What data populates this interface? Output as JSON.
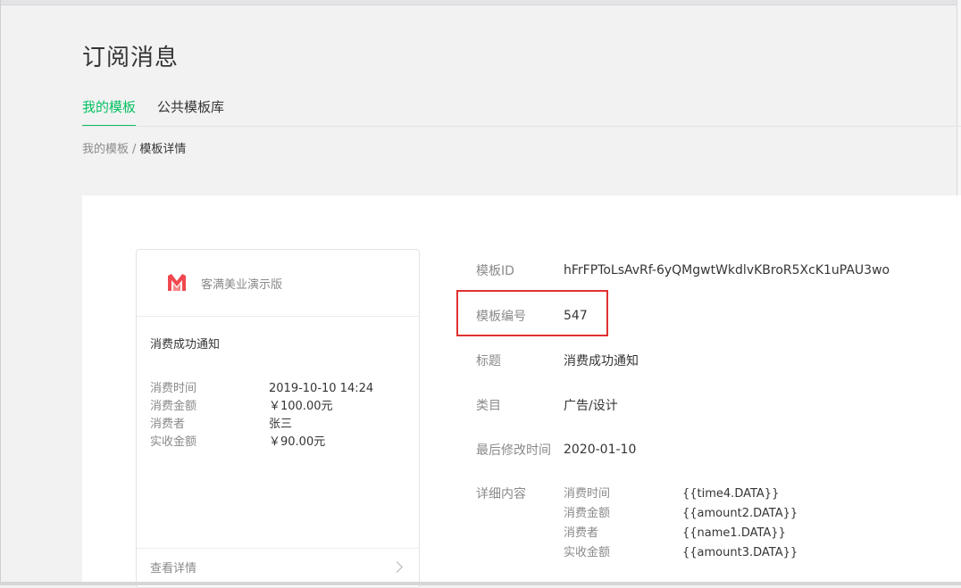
{
  "page": {
    "title": "订阅消息"
  },
  "tabs": [
    {
      "label": "我的模板",
      "active": true
    },
    {
      "label": "公共模板库",
      "active": false
    }
  ],
  "breadcrumb": {
    "parent": "我的模板",
    "separator": "/",
    "current": "模板详情"
  },
  "preview": {
    "app_name": "客满美业演示版",
    "message_title": "消费成功通知",
    "fields": [
      {
        "key": "消费时间",
        "value": "2019-10-10 14:24"
      },
      {
        "key": "消费金额",
        "value": "￥100.00元"
      },
      {
        "key": "消费者",
        "value": "张三"
      },
      {
        "key": "实收金额",
        "value": "￥90.00元"
      }
    ],
    "footer_label": "查看详情"
  },
  "info": {
    "template_id": {
      "label": "模板ID",
      "value": "hFrFPToLsAvRf-6yQMgwtWkdlvKBroR5XcK1uPAU3wo"
    },
    "template_number": {
      "label": "模板编号",
      "value": "547"
    },
    "title": {
      "label": "标题",
      "value": "消费成功通知"
    },
    "category": {
      "label": "类目",
      "value": "广告/设计"
    },
    "last_modified": {
      "label": "最后修改时间",
      "value": "2020-01-10"
    },
    "details": {
      "label": "详细内容",
      "rows": [
        {
          "key": "消费时间",
          "value": "{{time4.DATA}}"
        },
        {
          "key": "消费金额",
          "value": "{{amount2.DATA}}"
        },
        {
          "key": "消费者",
          "value": "{{name1.DATA}}"
        },
        {
          "key": "实收金额",
          "value": "{{amount3.DATA}}"
        }
      ]
    }
  },
  "colors": {
    "accent": "#07c160",
    "highlight": "#e03131",
    "logo": "#f0484e"
  }
}
